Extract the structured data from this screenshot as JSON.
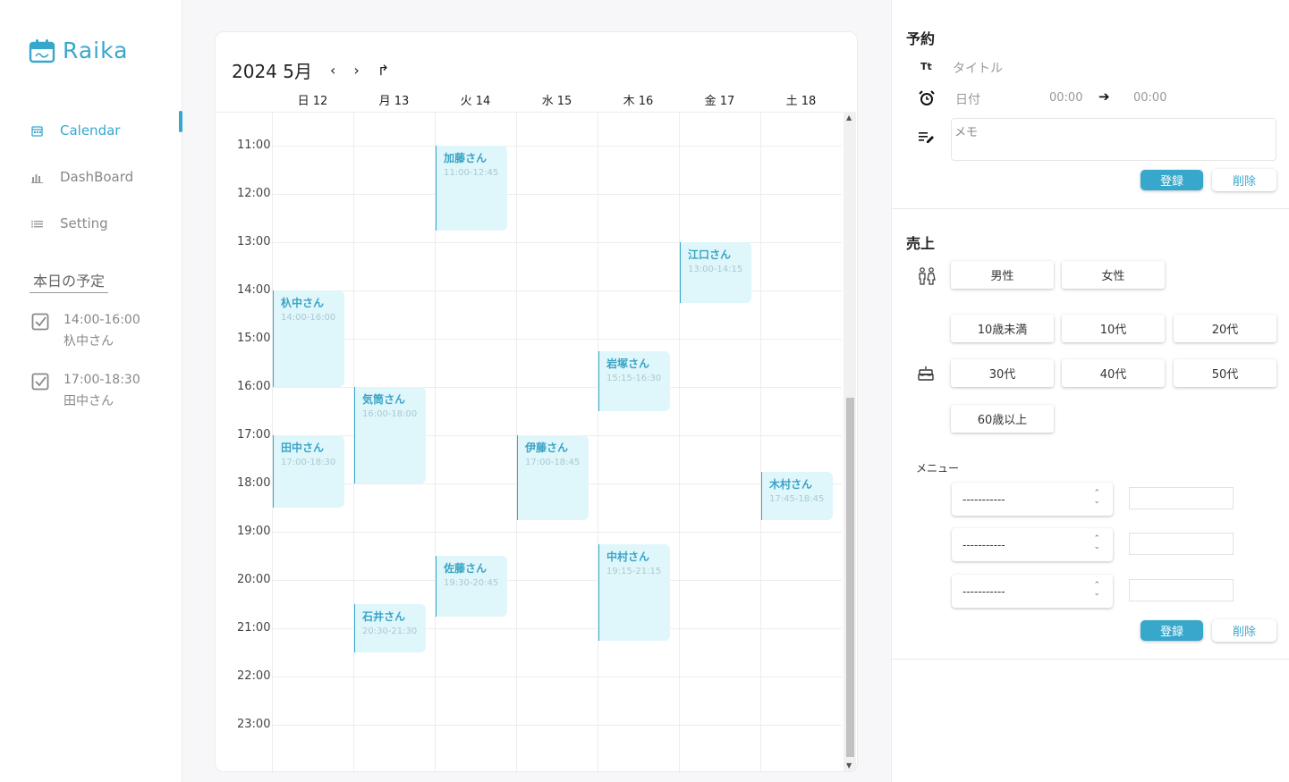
{
  "app": {
    "name": "Raika",
    "brand_color": "#38a7cc"
  },
  "sidebar": {
    "nav": [
      {
        "label": "Calendar",
        "icon": "calendar-icon",
        "active": true
      },
      {
        "label": "DashBoard",
        "icon": "bar-chart-icon",
        "active": false
      },
      {
        "label": "Setting",
        "icon": "list-icon",
        "active": false
      }
    ],
    "today_title": "本日の予定",
    "today": [
      {
        "time": "14:00-16:00",
        "name": "杁中さん"
      },
      {
        "time": "17:00-18:30",
        "name": "田中さん"
      }
    ]
  },
  "calendar": {
    "title": "2024 5月",
    "prev": "‹",
    "next": "›",
    "today_icon": "↱",
    "days": [
      "日 12",
      "月 13",
      "火 14",
      "水 15",
      "木 16",
      "金 17",
      "土 18"
    ],
    "hours": [
      "11:00",
      "12:00",
      "13:00",
      "14:00",
      "15:00",
      "16:00",
      "17:00",
      "18:00",
      "19:00",
      "20:00",
      "21:00",
      "22:00",
      "23:00"
    ],
    "events": [
      {
        "day": 2,
        "start": 11.0,
        "end": 12.75,
        "name": "加藤さん",
        "time": "11:00-12:45"
      },
      {
        "day": 5,
        "start": 13.0,
        "end": 14.25,
        "name": "江口さん",
        "time": "13:00-14:15"
      },
      {
        "day": 0,
        "start": 14.0,
        "end": 16.0,
        "name": "杁中さん",
        "time": "14:00-16:00"
      },
      {
        "day": 4,
        "start": 15.25,
        "end": 16.5,
        "name": "岩塚さん",
        "time": "15:15-16:30"
      },
      {
        "day": 1,
        "start": 16.0,
        "end": 18.0,
        "name": "気筒さん",
        "time": "16:00-18:00"
      },
      {
        "day": 0,
        "start": 17.0,
        "end": 18.5,
        "name": "田中さん",
        "time": "17:00-18:30"
      },
      {
        "day": 3,
        "start": 17.0,
        "end": 18.75,
        "name": "伊藤さん",
        "time": "17:00-18:45"
      },
      {
        "day": 6,
        "start": 17.75,
        "end": 18.75,
        "name": "木村さん",
        "time": "17:45-18:45"
      },
      {
        "day": 2,
        "start": 19.5,
        "end": 20.75,
        "name": "佐藤さん",
        "time": "19:30-20:45"
      },
      {
        "day": 4,
        "start": 19.25,
        "end": 21.25,
        "name": "中村さん",
        "time": "19:15-21:15"
      },
      {
        "day": 1,
        "start": 20.5,
        "end": 21.5,
        "name": "石井さん",
        "time": "20:30-21:30"
      }
    ]
  },
  "reservation": {
    "title": "予約",
    "title_field": "タイトル",
    "date_field": "日付",
    "start_time": "00:00",
    "arrow": "➔",
    "end_time": "00:00",
    "memo_placeholder": "メモ",
    "register": "登録",
    "delete": "削除"
  },
  "sales": {
    "title": "売上",
    "genders": [
      "男性",
      "女性"
    ],
    "ages": [
      "10歳未満",
      "10代",
      "20代",
      "30代",
      "40代",
      "50代",
      "60歳以上"
    ],
    "menu_label": "メニュー",
    "menu_selects": [
      "-----------",
      "-----------",
      "-----------"
    ],
    "register": "登録",
    "delete": "削除"
  }
}
